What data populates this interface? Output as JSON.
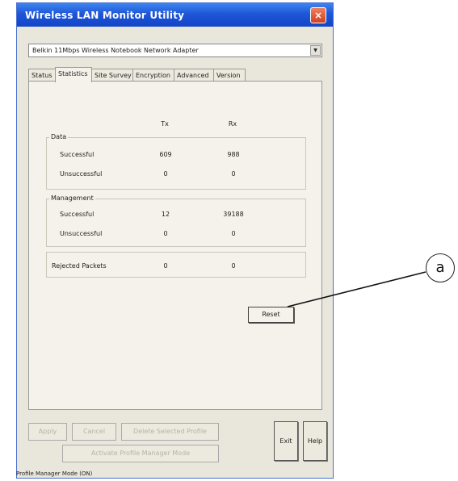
{
  "window": {
    "title": "Wireless LAN Monitor Utility",
    "close_symbol": "×"
  },
  "adapter": {
    "selected": "Belkin 11Mbps Wireless Notebook Network Adapter",
    "arrow": "▼"
  },
  "tabs": [
    {
      "label": "Status"
    },
    {
      "label": "Statistics"
    },
    {
      "label": "Site Survey"
    },
    {
      "label": "Encryption"
    },
    {
      "label": "Advanced"
    },
    {
      "label": "Version"
    }
  ],
  "statistics": {
    "col_tx": "Tx",
    "col_rx": "Rx",
    "data": {
      "label": "Data",
      "successful": {
        "label": "Successful",
        "tx": "609",
        "rx": "988"
      },
      "unsuccessful": {
        "label": "Unsuccessful",
        "tx": "0",
        "rx": "0"
      }
    },
    "management": {
      "label": "Management",
      "successful": {
        "label": "Successful",
        "tx": "12",
        "rx": "39188"
      },
      "unsuccessful": {
        "label": "Unsuccessful",
        "tx": "0",
        "rx": "0"
      }
    },
    "rejected": {
      "label": "Rejected Packets",
      "tx": "0",
      "rx": "0"
    }
  },
  "buttons": {
    "reset": "Reset",
    "apply": "Apply",
    "cancel": "Cancel",
    "delete_profile": "Delete Selected Profile",
    "activate_profile": "Activate Profile Manager Mode",
    "exit": "Exit",
    "help": "Help"
  },
  "status_bar": "Profile Manager Mode (ON)",
  "callout": {
    "label": "a"
  }
}
